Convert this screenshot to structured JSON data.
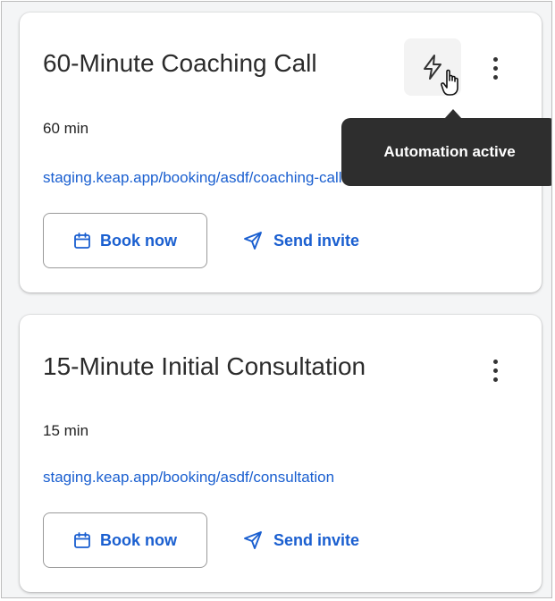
{
  "cards": [
    {
      "title": "60-Minute Coaching Call",
      "duration": "60 min",
      "link": "staging.keap.app/booking/asdf/coaching-call",
      "book_label": "Book now",
      "invite_label": "Send invite",
      "automation_tooltip": "Automation active"
    },
    {
      "title": "15-Minute Initial Consultation",
      "duration": "15 min",
      "link": "staging.keap.app/booking/asdf/consultation",
      "book_label": "Book now",
      "invite_label": "Send invite"
    }
  ],
  "colors": {
    "link": "#1a5fd0",
    "tooltip_bg": "#2e2e2e"
  },
  "icons": [
    "calendar-icon",
    "send-icon",
    "lightning-icon",
    "kebab-menu-icon",
    "hand-cursor-icon"
  ]
}
